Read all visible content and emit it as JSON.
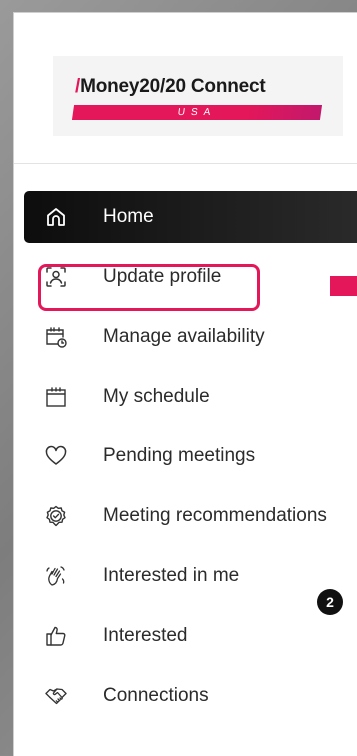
{
  "brand": {
    "logo_main": "Money20/20 Connect",
    "logo_slash": "/",
    "logo_region": "USA",
    "accent_color": "#e4175a"
  },
  "nav": {
    "items": [
      {
        "label": "Home",
        "icon": "home-icon",
        "active": true
      },
      {
        "label": "Update profile",
        "icon": "profile-icon",
        "active": false
      },
      {
        "label": "Manage availability",
        "icon": "calendar-clock-icon",
        "active": false
      },
      {
        "label": "My schedule",
        "icon": "calendar-icon",
        "active": false
      },
      {
        "label": "Pending meetings",
        "icon": "heart-icon",
        "active": false
      },
      {
        "label": "Meeting recommendations",
        "icon": "badge-check-icon",
        "active": false
      },
      {
        "label": "Interested in me",
        "icon": "wave-hand-icon",
        "active": false,
        "badge": "2"
      },
      {
        "label": "Interested",
        "icon": "thumbs-up-icon",
        "active": false
      },
      {
        "label": "Connections",
        "icon": "handshake-icon",
        "active": false
      }
    ]
  }
}
